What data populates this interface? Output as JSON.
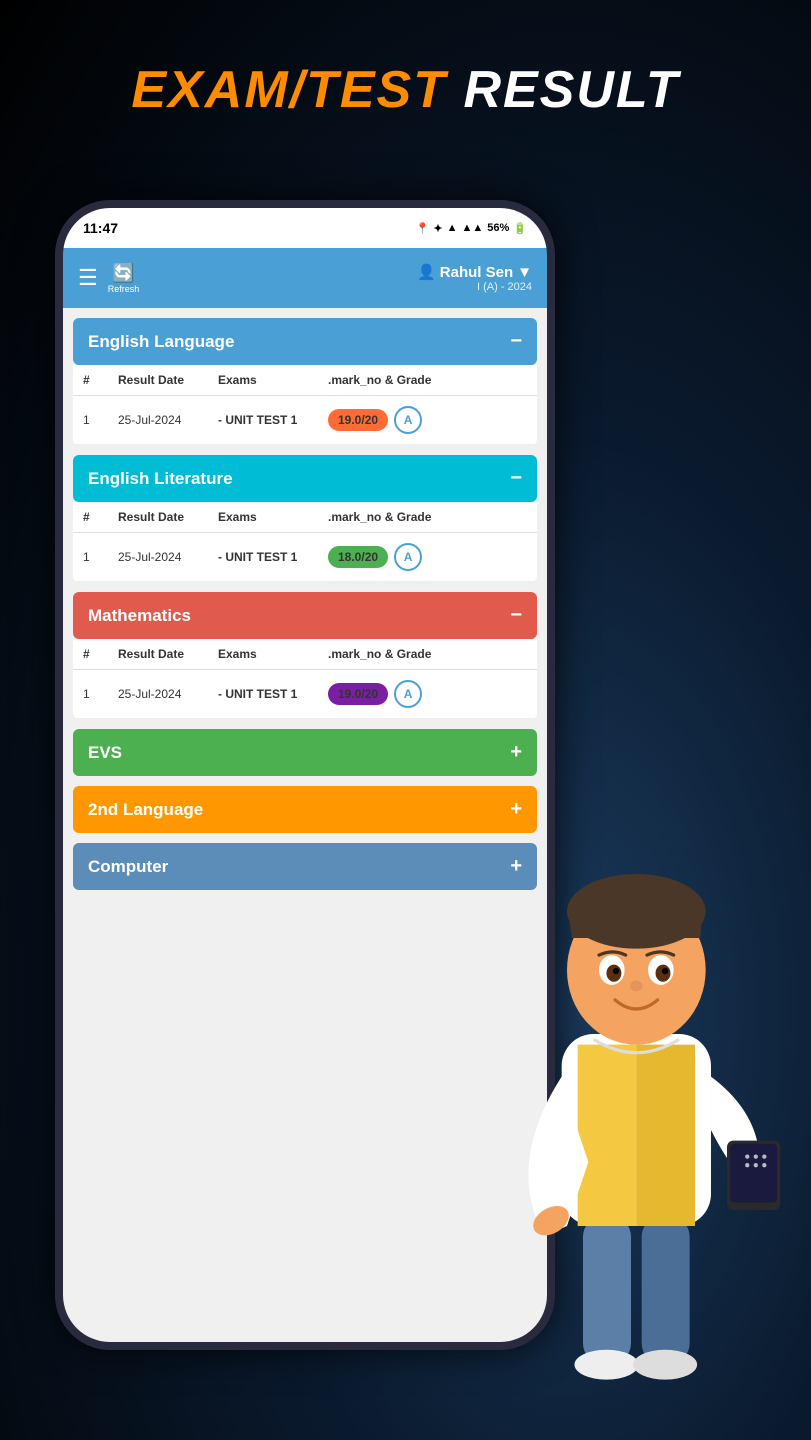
{
  "page": {
    "title_exam": "EXAM/TEST",
    "title_result": "RESULT",
    "background_color": "#000"
  },
  "status_bar": {
    "time": "11:47",
    "battery": "56%",
    "signal": "▲▲"
  },
  "header": {
    "user_name": "Rahul Sen",
    "user_class": "I (A) - 2024",
    "refresh_label": "Refresh"
  },
  "subjects": [
    {
      "name": "English Language",
      "color": "blue",
      "expanded": true,
      "toggle": "−",
      "columns": [
        "#",
        "Result Date",
        "Exams",
        ".mark_no & Grade"
      ],
      "rows": [
        {
          "num": "1",
          "date": "25-Jul-2024",
          "exam": "- UNIT TEST 1",
          "marks": "19.0/20",
          "grade": "A",
          "marks_color": "orange"
        }
      ]
    },
    {
      "name": "English Literature",
      "color": "light-blue",
      "expanded": true,
      "toggle": "−",
      "columns": [
        "#",
        "Result Date",
        "Exams",
        ".mark_no & Grade"
      ],
      "rows": [
        {
          "num": "1",
          "date": "25-Jul-2024",
          "exam": "- UNIT TEST 1",
          "marks": "18.0/20",
          "grade": "A",
          "marks_color": "green"
        }
      ]
    },
    {
      "name": "Mathematics",
      "color": "red",
      "expanded": true,
      "toggle": "−",
      "columns": [
        "#",
        "Result Date",
        "Exams",
        ".mark_no & Grade"
      ],
      "rows": [
        {
          "num": "1",
          "date": "25-Jul-2024",
          "exam": "- UNIT TEST 1",
          "marks": "19.0/20",
          "grade": "A",
          "marks_color": "purple"
        }
      ]
    },
    {
      "name": "EVS",
      "color": "green",
      "expanded": false,
      "toggle": "+"
    },
    {
      "name": "2nd Language",
      "color": "orange",
      "expanded": false,
      "toggle": "+"
    },
    {
      "name": "Computer",
      "color": "steel-blue",
      "expanded": false,
      "toggle": "+"
    }
  ]
}
